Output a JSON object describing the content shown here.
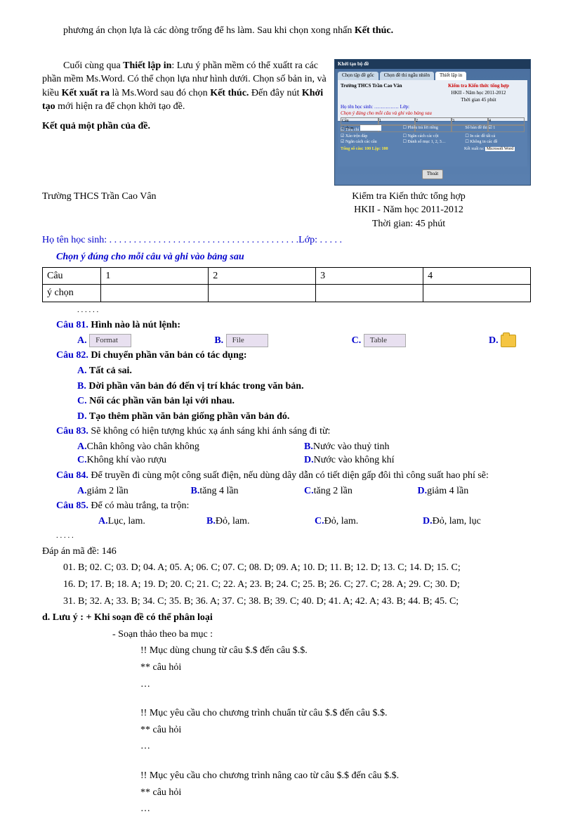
{
  "intro": {
    "line1_pre": "phương án chọn lựa là các dòng trống để hs làm. Sau khi chọn xong nhấn ",
    "line1_bold": "Kết thúc."
  },
  "para2": {
    "t1": "Cuối cùng qua ",
    "b1": "Thiết lập in",
    "t2": ": Lưu ý phần mềm có thể xuấtt ra các phần mềm Ms.Word. Có thể chọn lựa như hình dưới. Chọn số bản in, và kiều ",
    "b2": "Kết xuất ra",
    "t3": " là Ms.Word sau đó chọn ",
    "b3": "Kết thúc.",
    "t4": " Đến đây nút ",
    "b4": "Khởi tạo",
    "t5": " mới hiện ra để chọn khởi tạo đề."
  },
  "section_title": "Kết quả một phần của đề.",
  "exam_header": {
    "school": "Trường THCS Trần Cao Vân",
    "title": "Kiểm tra Kiến thức tổng hợp",
    "sub": "HKII - Năm học 2011-2012",
    "time": "Thời gian: 45 phút"
  },
  "student_line": {
    "label": "Họ tên học sinh:",
    "dots": ". . . . . . . . . . . . . . . . . . . . . . . . . . . . . . . . . . . . . . .",
    "lop": "Lớp: . . . . .",
    "instr": "Chọn ý đúng cho mỗi câu và ghi vào bảng sau"
  },
  "table": {
    "h0": "Câu",
    "h1": "1",
    "h2": "2",
    "h3": "3",
    "h4": "4",
    "r0": "ý chọn"
  },
  "dots_small": ". . . . . .",
  "q81": {
    "num": "Câu 81.",
    "text": " Hình nào là nút lệnh:",
    "A": "A.",
    "B": "B.",
    "C": "C.",
    "D": "D.",
    "opt_a": "Format",
    "opt_b": "File",
    "opt_c": "Table"
  },
  "q82": {
    "num": "Câu 82.",
    "text": " Di chuyển phần văn bản có tác dụng:",
    "A": "A. ",
    "At": "Tất cả sai.",
    "B": "B. ",
    "Bt": "Dời phần văn bản đó đến vị trí khác trong văn bản.",
    "C": "C. ",
    "Ct": "Nối các phần văn bản lại với nhau.",
    "D": "D. ",
    "Dt": "Tạo thêm phần văn bản giống phần văn bản đó."
  },
  "q83": {
    "num": "Câu 83.",
    "text": " Sẽ không có hiện tượng khúc xạ ánh sáng khi ánh sáng đi từ:",
    "A": "A.",
    "At": "Chân không vào chân không",
    "B": "B.",
    "Bt": "Nước vào thuỷ tinh",
    "C": "C.",
    "Ct": "Không khí vào rượu",
    "D": "D.",
    "Dt": "Nước vào không khí"
  },
  "q84": {
    "num": "Câu 84.",
    "text": " Để truyền đi cùng một công suất điện, nếu dùng dây dẫn có tiết diện gấp đôi thì công suất hao phí sẽ:",
    "A": "A.",
    "At": "giảm 2 lần",
    "B": "B.",
    "Bt": "tăng 4 lần",
    "C": "C.",
    "Ct": "tăng 2 lần",
    "D": "D.",
    "Dt": "giảm 4 lần"
  },
  "q85": {
    "num": "Câu 85.",
    "text": " Để có màu trắng, ta trộn:",
    "A": "A.",
    "At": "Lục, lam.",
    "B": "B.",
    "Bt": "Đỏ, lam.",
    "C": "C.",
    "Ct": "Đỏ, lam.",
    "D": "D.",
    "Dt": "Đỏ, lam, lục"
  },
  "answers": {
    "title": "Đáp án mã đề: 146",
    "l1": "01. B; 02. C; 03. D; 04. A; 05. A; 06. C; 07. C; 08. D; 09. A; 10. D; 11. B; 12. D; 13. C; 14. D; 15. C;",
    "l2": "16. D; 17. B; 18. A; 19. D; 20. C; 21. C; 22. A; 23. B; 24. C; 25. B; 26. C; 27. C; 28. A; 29. C; 30. D;",
    "l3": "31. B; 32. A; 33. B; 34. C; 35. B; 36. A; 37. C; 38. B; 39. C; 40. D; 41. A; 42. A; 43. B; 44. B; 45. C;"
  },
  "notes": {
    "d_title": "d. Lưu ý :  + Khi soạn đề có thể phân loại",
    "n1": "- Soạn thảo theo ba mục :",
    "n2": "!! Mục dùng chung từ câu $.$ đến câu $.$.",
    "n3": "** câu hỏi",
    "n4": "…",
    "n5": "!! Mục yêu cầu cho chương trình chuẩn từ câu $.$ đến câu $.$.",
    "n6": "** câu hỏi",
    "n7": "…",
    "n8": "!! Mục yêu cầu cho chương trình nâng cao từ câu $.$ đến câu $.$.",
    "n9": "** câu hỏi",
    "n10": "…"
  },
  "dialog": {
    "title": "Khởi tạo bộ đề",
    "tab1": "Chọn tập đề gốc",
    "tab2": "Chọn đề thi ngẫu nhiên",
    "tab3": "Thiết lập in",
    "school_label": "Trường THCS Trần Cao Vân",
    "exam_label": "Kiểm tra Kiến thức tổng hợp",
    "sub_label": "HKII - Năm học 2011-2012",
    "time_label": "Thời gian 45 phút",
    "student_label": "Họ tên học sinh:",
    "lop": "Lớp:",
    "instr": "Chọn ý đúng cho mỗi câu và ghi vào bảng sau",
    "row_cau": "Câu",
    "row_ychon": "ý chọn",
    "total": "Tổng số câu: 100  Lặp: 100",
    "ketxuat": "Kết xuất ra:",
    "word": "Microsoft Word",
    "btn_thoat": "Thoát"
  }
}
